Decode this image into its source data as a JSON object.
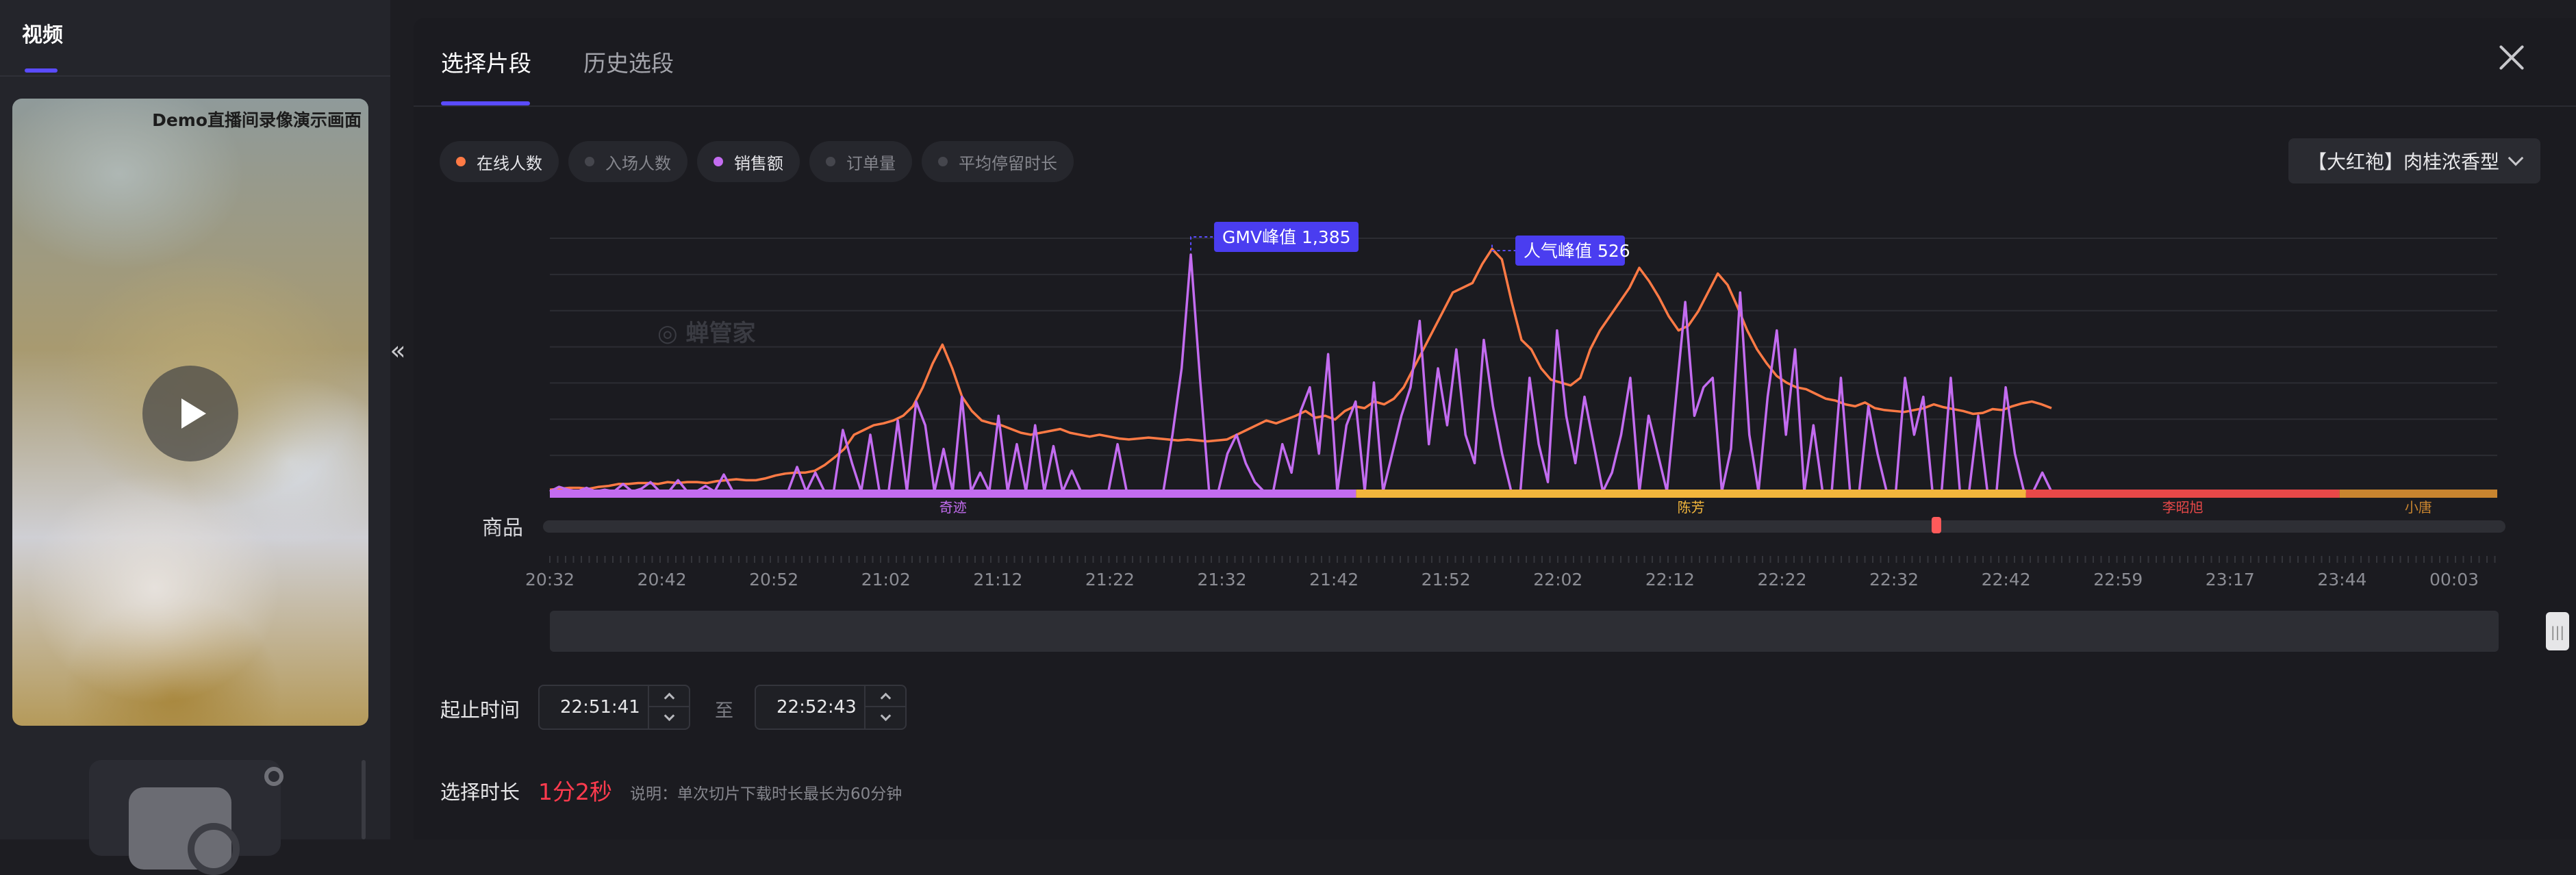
{
  "left_panel": {
    "tab_label": "视频",
    "video_caption": "Demo直播间录像演示画面"
  },
  "modal": {
    "tabs": [
      {
        "label": "选择片段",
        "active": true
      },
      {
        "label": "历史选段",
        "active": false
      }
    ]
  },
  "legend": [
    {
      "label": "在线人数",
      "active": true,
      "color": "#ff7a45"
    },
    {
      "label": "入场人数",
      "active": false,
      "color": "#45464d"
    },
    {
      "label": "销售额",
      "active": true,
      "color": "#c36cf0"
    },
    {
      "label": "订单量",
      "active": false,
      "color": "#45464d"
    },
    {
      "label": "平均停留时长",
      "active": false,
      "color": "#45464d"
    }
  ],
  "product_select": {
    "value": "【大红袍】肉桂浓香型"
  },
  "chart_data": {
    "type": "line",
    "watermark": "蝉管家",
    "series": [
      {
        "name": "在线人数",
        "color": "#ff7a45",
        "values": [
          2,
          3,
          4,
          4,
          3,
          5,
          6,
          8,
          8,
          9,
          9,
          8,
          10,
          9,
          10,
          10,
          9,
          11,
          12,
          13,
          12,
          12,
          14,
          17,
          19,
          20,
          20,
          22,
          28,
          36,
          45,
          60,
          65,
          70,
          72,
          75,
          80,
          90,
          110,
          135,
          155,
          130,
          100,
          85,
          75,
          72,
          70,
          66,
          62,
          60,
          62,
          64,
          66,
          62,
          60,
          58,
          60,
          58,
          56,
          55,
          56,
          57,
          56,
          55,
          54,
          55,
          54,
          53,
          54,
          55,
          60,
          65,
          70,
          75,
          72,
          76,
          80,
          85,
          78,
          80,
          76,
          85,
          90,
          88,
          95,
          92,
          98,
          110,
          130,
          150,
          170,
          190,
          210,
          215,
          220,
          240,
          256,
          245,
          200,
          160,
          150,
          130,
          118,
          115,
          112,
          120,
          150,
          170,
          185,
          200,
          215,
          236,
          222,
          205,
          185,
          170,
          175,
          190,
          210,
          230,
          218,
          195,
          170,
          150,
          135,
          122,
          115,
          110,
          108,
          103,
          98,
          96,
          92,
          90,
          94,
          88,
          86,
          85,
          84,
          86,
          88,
          92,
          89,
          87,
          85,
          82,
          83,
          87,
          86,
          90,
          93,
          95,
          92,
          88
        ],
        "peak_label": "人气峰值 526"
      },
      {
        "name": "销售额",
        "color": "#c36cf0",
        "values": [
          0,
          5,
          2,
          0,
          4,
          0,
          2,
          0,
          8,
          0,
          3,
          10,
          0,
          0,
          12,
          0,
          0,
          6,
          0,
          18,
          0,
          0,
          0,
          0,
          0,
          0,
          0,
          26,
          0,
          20,
          0,
          0,
          65,
          30,
          0,
          60,
          0,
          0,
          75,
          0,
          95,
          70,
          0,
          45,
          0,
          100,
          0,
          20,
          0,
          80,
          0,
          50,
          0,
          70,
          0,
          48,
          0,
          22,
          0,
          0,
          0,
          0,
          50,
          0,
          0,
          0,
          0,
          0,
          60,
          130,
          250,
          120,
          0,
          0,
          40,
          60,
          30,
          10,
          0,
          0,
          50,
          20,
          85,
          110,
          40,
          145,
          0,
          70,
          95,
          0,
          115,
          0,
          40,
          80,
          110,
          180,
          50,
          130,
          70,
          150,
          60,
          30,
          160,
          90,
          40,
          0,
          0,
          120,
          50,
          10,
          170,
          80,
          30,
          100,
          50,
          0,
          20,
          60,
          120,
          0,
          80,
          40,
          0,
          100,
          200,
          80,
          110,
          120,
          0,
          45,
          210,
          60,
          0,
          100,
          170,
          60,
          150,
          0,
          70,
          0,
          0,
          120,
          0,
          0,
          90,
          40,
          0,
          0,
          120,
          60,
          100,
          0,
          0,
          120,
          0,
          0,
          80,
          0,
          0,
          110,
          40,
          0,
          0,
          20,
          0
        ],
        "peak_label": "GMV峰值 1,385"
      }
    ],
    "x_ticks": [
      "20:32",
      "20:42",
      "20:52",
      "21:02",
      "21:12",
      "21:22",
      "21:32",
      "21:42",
      "21:52",
      "22:02",
      "22:12",
      "22:22",
      "22:32",
      "22:42",
      "22:59",
      "23:17",
      "23:44",
      "00:03"
    ],
    "segments": [
      {
        "name": "奇迹",
        "color": "#c36cf0",
        "start": 0,
        "end": 0.414
      },
      {
        "name": "陈芳",
        "color": "#f2b63c",
        "start": 0.414,
        "end": 0.758
      },
      {
        "name": "李昭旭",
        "color": "#e84848",
        "start": 0.758,
        "end": 0.919
      },
      {
        "name": "小唐",
        "color": "#c9852f",
        "start": 0.919,
        "end": 1.0
      }
    ],
    "goods_label": "商品",
    "goods_marker": 0.712,
    "grid": true
  },
  "form": {
    "range_label": "起止时间",
    "start_time": "22:51:41",
    "to_label": "至",
    "end_time": "22:52:43",
    "duration_label": "选择时长",
    "duration_value": "1分2秒",
    "duration_note": "说明：单次切片下载时长最长为60分钟"
  }
}
